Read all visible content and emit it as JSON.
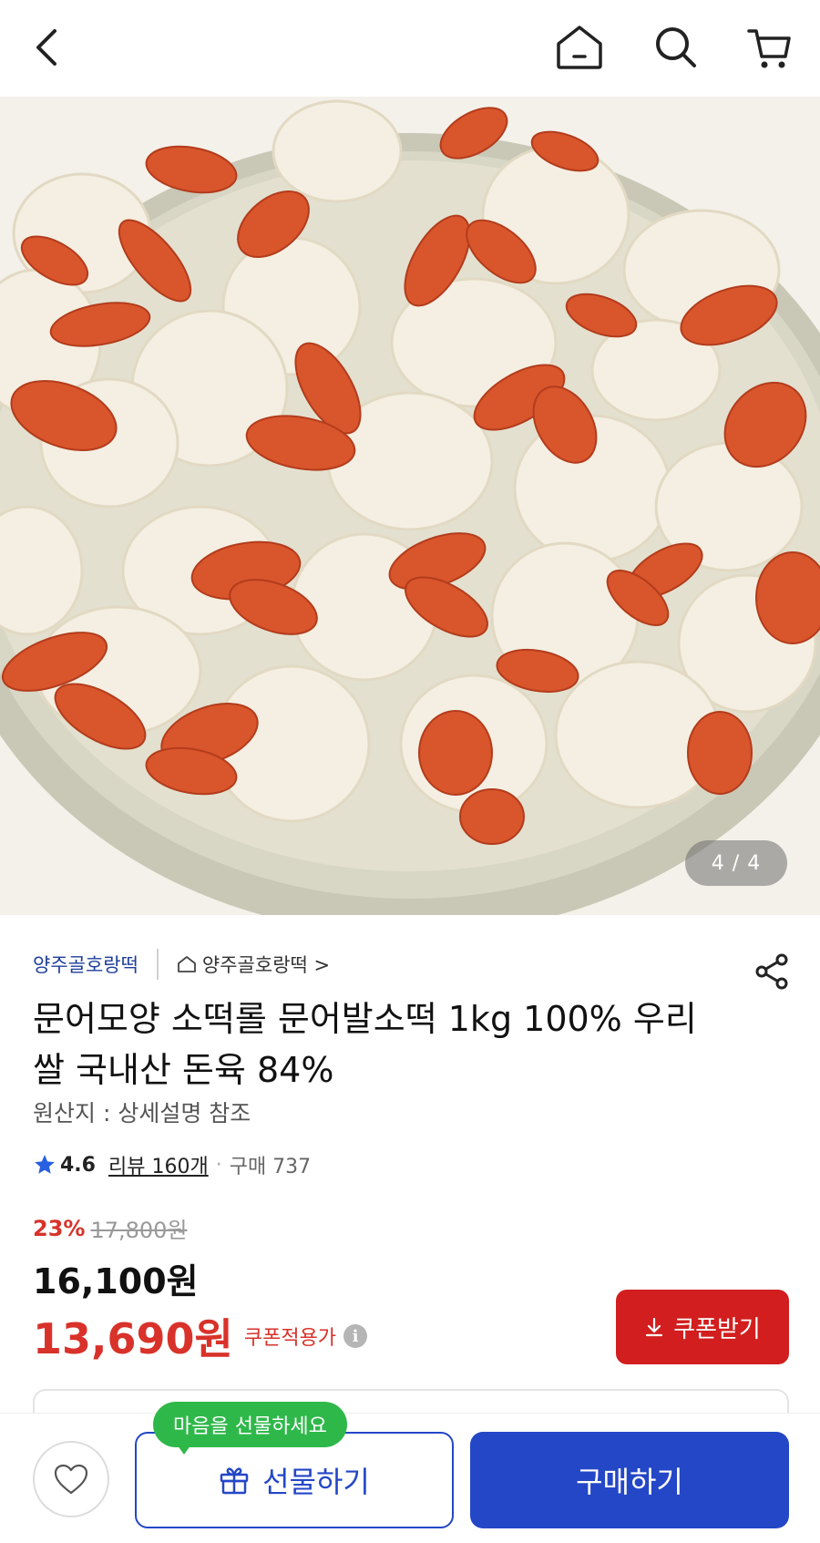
{
  "header": {
    "back_icon": "chevron-left-icon",
    "home_icon": "home-icon",
    "search_icon": "search-icon",
    "cart_icon": "cart-icon"
  },
  "gallery": {
    "counter": "4 / 4"
  },
  "seller": {
    "name": "양주골호랑떡",
    "store_link": "양주골호랑떡 >"
  },
  "product": {
    "title": "문어모양 소떡롤 문어발소떡 1kg 100% 우리쌀 국내산 돈육 84%",
    "origin": "원산지 : 상세설명 참조",
    "rating": "4.6",
    "review": "리뷰 160개",
    "dot": "·",
    "purchases": "구매 737"
  },
  "price": {
    "discount_rate": "23%",
    "original": "17,800원",
    "sale": "16,100원",
    "coupon_price": "13,690원",
    "coupon_note": "쿠폰적용가",
    "info_icon": "i"
  },
  "coupon_button": {
    "label": "쿠폰받기"
  },
  "bottom": {
    "tooltip": "마음을 선물하세요",
    "gift_label": "선물하기",
    "buy_label": "구매하기"
  },
  "colors": {
    "accent_blue": "#2447c7",
    "sale_red": "#d8322a",
    "coupon_red": "#d21e1e",
    "tooltip_green": "#2fb84a",
    "seller_blue": "#1f3f9b"
  }
}
